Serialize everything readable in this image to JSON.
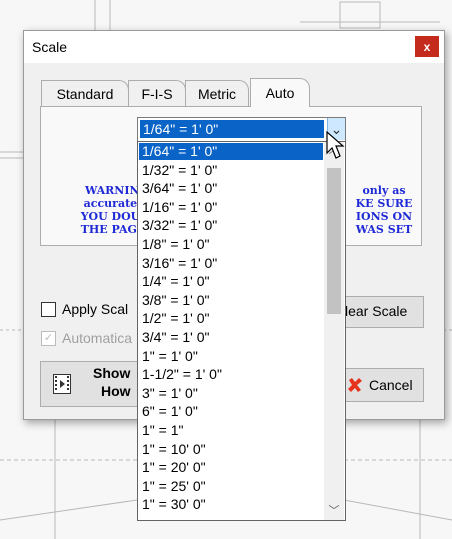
{
  "dialog": {
    "title": "Scale",
    "close_glyph": "x",
    "tabs": [
      {
        "label": "Standard"
      },
      {
        "label": "F-I-S"
      },
      {
        "label": "Metric"
      },
      {
        "label": "Auto",
        "active": true
      }
    ],
    "warning_left": [
      "WARNING:",
      "accurate as",
      "YOU DOUBL",
      "THE PAGE T"
    ],
    "warning_right": [
      "only as",
      "KE SURE",
      "IONS ON",
      "WAS SET"
    ],
    "apply_scale_label": "Apply Scal",
    "automatic_label": "Automatica",
    "clear_scale_label": "lear Scale",
    "show_how_label_1": "Show",
    "show_how_label_2": "How",
    "cancel_label": "Cancel",
    "cancel_icon": "x-mark-icon",
    "video_icon": "film-icon"
  },
  "scale_combo": {
    "selected": "1/64\" = 1' 0\"",
    "options": [
      "1/64\" = 1' 0\"",
      "1/32\" = 1' 0\"",
      "3/64\" = 1' 0\"",
      "1/16\" = 1' 0\"",
      "3/32\" = 1' 0\"",
      "1/8\" = 1' 0\"",
      "3/16\" = 1' 0\"",
      "1/4\" = 1' 0\"",
      "3/8\" = 1' 0\"",
      "1/2\" = 1' 0\"",
      "3/4\" = 1' 0\"",
      "1\" = 1' 0\"",
      "1-1/2\" = 1' 0\"",
      "3\" = 1' 0\"",
      "6\" = 1' 0\"",
      "1\" = 1\"",
      "1\" = 10' 0\"",
      "1\" = 20' 0\"",
      "1\" = 25' 0\"",
      "1\" = 30' 0\""
    ]
  },
  "colors": {
    "selection": "#0a64c8",
    "warning_text": "#1f2ad6",
    "close_button": "#c42b1c",
    "cancel_icon": "#e8331c"
  }
}
